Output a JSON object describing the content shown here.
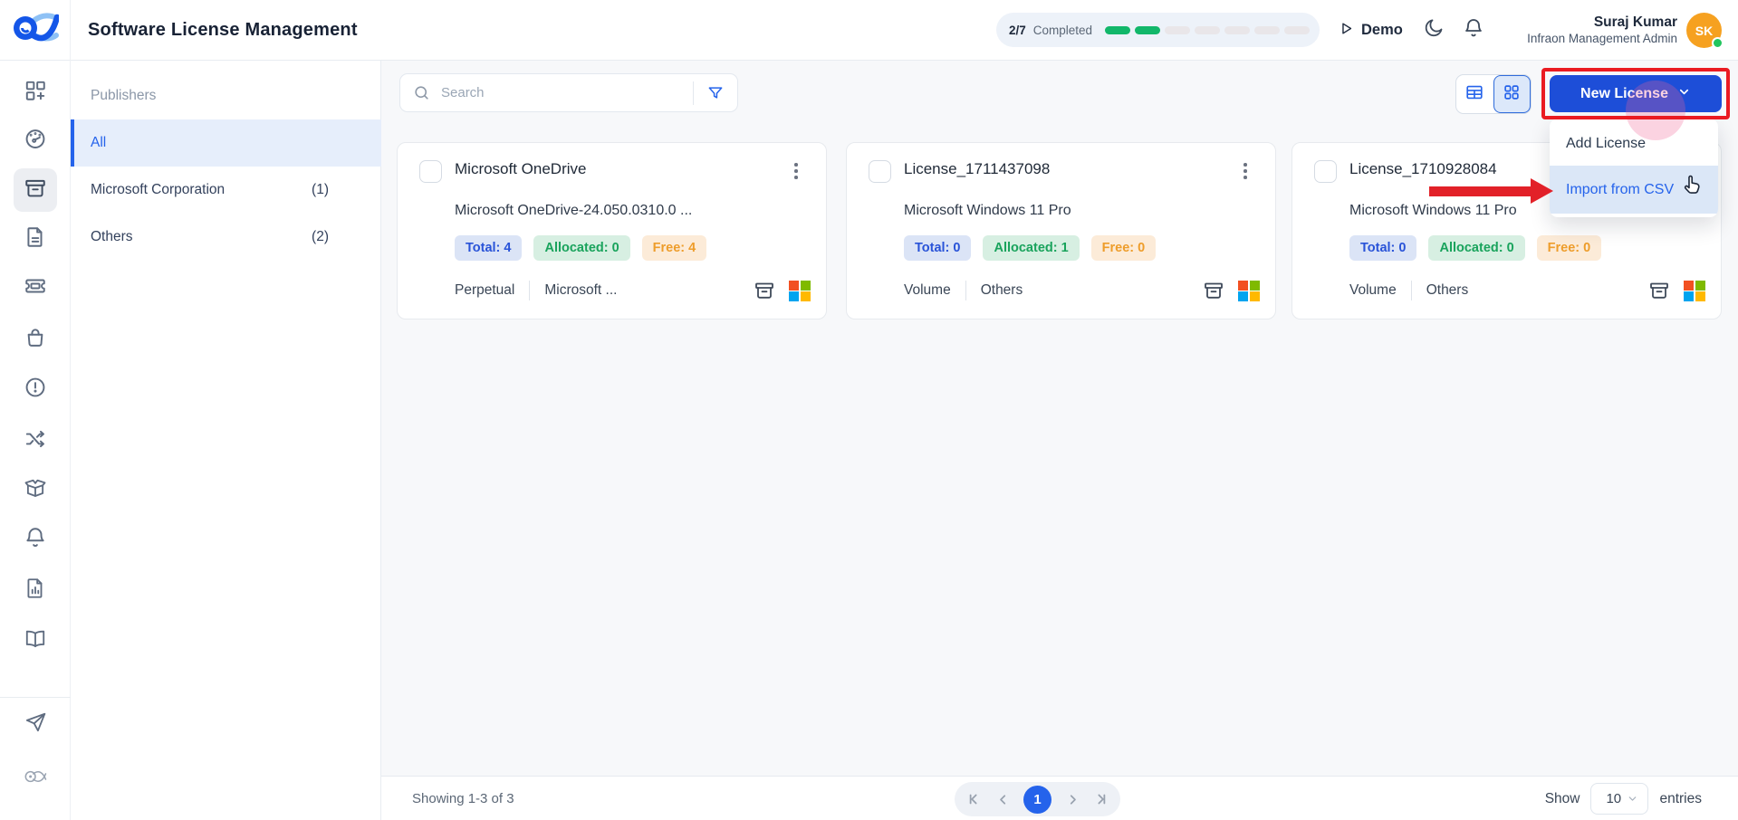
{
  "header": {
    "title": "Software License Management",
    "progress": {
      "label": "2/7",
      "status": "Completed",
      "total_segments": 7,
      "completed_segments": 2
    },
    "demo_label": "Demo",
    "user": {
      "name": "Suraj Kumar",
      "role": "Infraon Management Admin",
      "initials": "SK"
    }
  },
  "sidebar": {
    "items": [
      {
        "icon": "apps-plus-icon"
      },
      {
        "icon": "gauge-icon"
      },
      {
        "icon": "archive-icon",
        "active": true
      },
      {
        "icon": "document-icon"
      },
      {
        "icon": "ticket-icon"
      },
      {
        "icon": "shopping-bag-icon"
      },
      {
        "icon": "alert-circle-icon"
      },
      {
        "icon": "shuffle-icon"
      },
      {
        "icon": "package-icon"
      },
      {
        "icon": "bell-icon"
      },
      {
        "icon": "report-icon"
      },
      {
        "icon": "book-icon"
      },
      {
        "icon": "paper-plane-icon"
      },
      {
        "icon": "fish-logo-muted-icon"
      }
    ]
  },
  "publishers": {
    "heading": "Publishers",
    "items": [
      {
        "label": "All",
        "count": "",
        "active": true
      },
      {
        "label": "Microsoft Corporation",
        "count": "(1)",
        "active": false
      },
      {
        "label": "Others",
        "count": "(2)",
        "active": false
      }
    ]
  },
  "toolbar": {
    "search_placeholder": "Search",
    "new_license_label": "New License"
  },
  "dropdown": {
    "items": [
      {
        "label": "Add License",
        "highlighted": false
      },
      {
        "label": "Import from CSV",
        "highlighted": true
      }
    ]
  },
  "cards": [
    {
      "title": "Microsoft OneDrive",
      "subtitle": "Microsoft OneDrive-24.050.0310.0 ...",
      "badges": {
        "total": "Total: 4",
        "allocated": "Allocated: 0",
        "free": "Free: 4"
      },
      "license_type": "Perpetual",
      "publisher": "Microsoft ..."
    },
    {
      "title": "License_1711437098",
      "subtitle": "Microsoft Windows 11 Pro",
      "badges": {
        "total": "Total: 0",
        "allocated": "Allocated: 1",
        "free": "Free: 0"
      },
      "license_type": "Volume",
      "publisher": "Others"
    },
    {
      "title": "License_1710928084",
      "subtitle": "Microsoft Windows 11 Pro",
      "badges": {
        "total": "Total: 0",
        "allocated": "Allocated: 0",
        "free": "Free: 0"
      },
      "license_type": "Volume",
      "publisher": "Others"
    }
  ],
  "pagination": {
    "showing": "Showing 1-3 of 3",
    "page": "1",
    "show_label": "Show",
    "page_size": "10",
    "entries_label": "entries"
  },
  "colors": {
    "primary_blue": "#1d4ed8",
    "link_blue": "#2563eb",
    "progress_green": "#12b76a",
    "avatar_orange": "#f6a120",
    "annotation_red": "#ea1b22",
    "badge_total_bg": "#dbe4f6",
    "badge_allocated_bg": "#d7efe2",
    "badge_free_bg": "#fcebd8",
    "selected_row_bg": "#e6eefb",
    "content_bg": "#f7f8fa"
  },
  "icons": {
    "search": "magnifier",
    "filter": "funnel",
    "view_list": "table-grid",
    "view_grid": "four-squares",
    "demo": "play-triangle",
    "theme": "crescent-moon",
    "notifications": "bell",
    "card_menu": "kebab-dots",
    "card_archive": "archive-box",
    "card_brand": "microsoft-four-squares",
    "pager": "first/prev/next/last chevrons",
    "annotation": "red-arrow-right, hand-cursor"
  }
}
